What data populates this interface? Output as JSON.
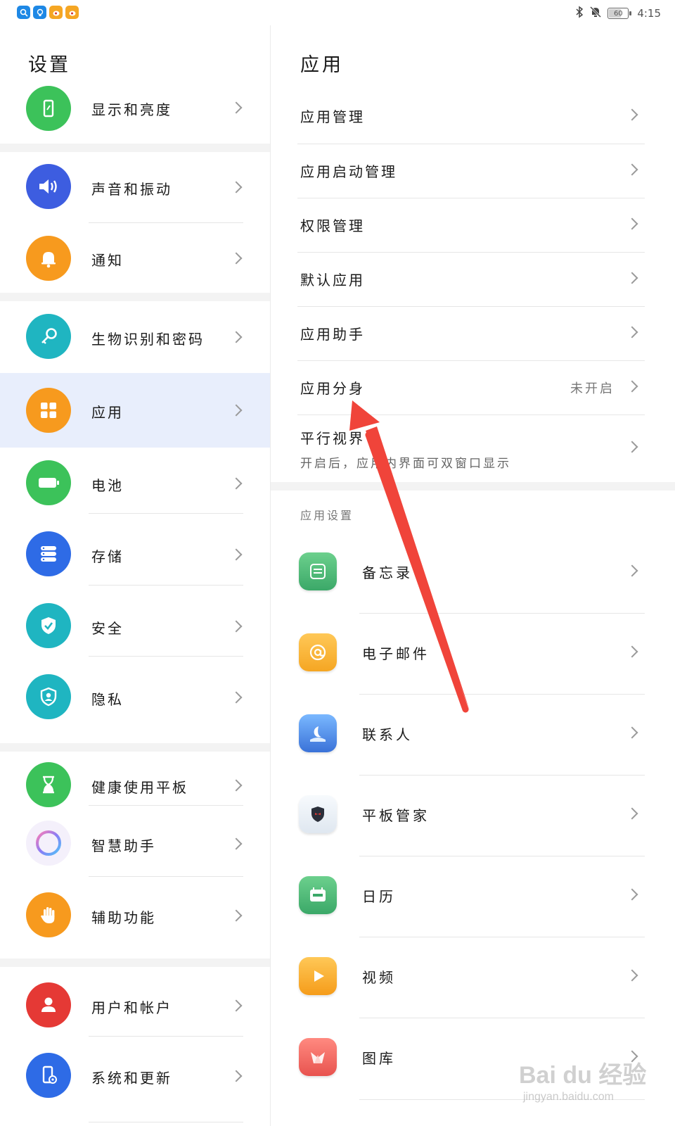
{
  "status_bar": {
    "notification_apps": [
      {
        "icon": "search-app-icon",
        "color": "#1e88e5",
        "glyph": "🔍"
      },
      {
        "icon": "bulb-app-icon",
        "color": "#1e88e5",
        "glyph": "💡"
      },
      {
        "icon": "weibo-app-icon",
        "color": "#f5a623",
        "glyph": "◉"
      },
      {
        "icon": "weibo-app-icon",
        "color": "#f5a623",
        "glyph": "◉"
      }
    ],
    "battery_level": "60",
    "time": "4:15"
  },
  "left": {
    "title": "设置",
    "items": [
      {
        "label": "显示和亮度",
        "icon": "display-icon",
        "color": "#3cc25a"
      },
      {
        "label": "声音和振动",
        "icon": "speaker-icon",
        "color": "#3d5de0"
      },
      {
        "label": "通知",
        "icon": "bell-icon",
        "color": "#f79a1e"
      },
      {
        "label": "生物识别和密码",
        "icon": "key-icon",
        "color": "#1fb5c1"
      },
      {
        "label": "应用",
        "icon": "apps-grid-icon",
        "color": "#f79a1e",
        "selected": true
      },
      {
        "label": "电池",
        "icon": "battery-icon",
        "color": "#3cc25a"
      },
      {
        "label": "存储",
        "icon": "storage-icon",
        "color": "#2e6be6"
      },
      {
        "label": "安全",
        "icon": "shield-check-icon",
        "color": "#1fb5c1"
      },
      {
        "label": "隐私",
        "icon": "privacy-icon",
        "color": "#1fb5c1"
      },
      {
        "label": "健康使用平板",
        "icon": "hourglass-icon",
        "color": "#3cc25a"
      },
      {
        "label": "智慧助手",
        "icon": "assistant-ring-icon",
        "color": "#b57cf0"
      },
      {
        "label": "辅助功能",
        "icon": "hand-icon",
        "color": "#f79a1e"
      },
      {
        "label": "用户和帐户",
        "icon": "user-icon",
        "color": "#e53935"
      },
      {
        "label": "系统和更新",
        "icon": "system-update-icon",
        "color": "#2e6be6"
      }
    ]
  },
  "right": {
    "title": "应用",
    "items": [
      {
        "label": "应用管理"
      },
      {
        "label": "应用启动管理"
      },
      {
        "label": "权限管理"
      },
      {
        "label": "默认应用"
      },
      {
        "label": "应用助手"
      },
      {
        "label": "应用分身",
        "value": "未开启"
      },
      {
        "label": "平行视界",
        "subtitle": "开启后，应用内界面可双窗口显示"
      }
    ],
    "section_title": "应用设置",
    "apps": [
      {
        "label": "备忘录",
        "icon": "notes-app-icon",
        "color": "#4cb870"
      },
      {
        "label": "电子邮件",
        "icon": "email-app-icon",
        "color": "#f5a623"
      },
      {
        "label": "联系人",
        "icon": "contacts-app-icon",
        "color": "#4a8df0"
      },
      {
        "label": "平板管家",
        "icon": "tablet-manager-icon",
        "color": "#e8eef5"
      },
      {
        "label": "日历",
        "icon": "calendar-app-icon",
        "color": "#4cb870"
      },
      {
        "label": "视频",
        "icon": "video-app-icon",
        "color": "#f5a623"
      },
      {
        "label": "图库",
        "icon": "gallery-app-icon",
        "color": "#e8534f"
      }
    ]
  },
  "watermark": {
    "main": "Bai du 经验",
    "sub": "jingyan.baidu.com"
  },
  "annotation_arrow_color": "#f0443a"
}
